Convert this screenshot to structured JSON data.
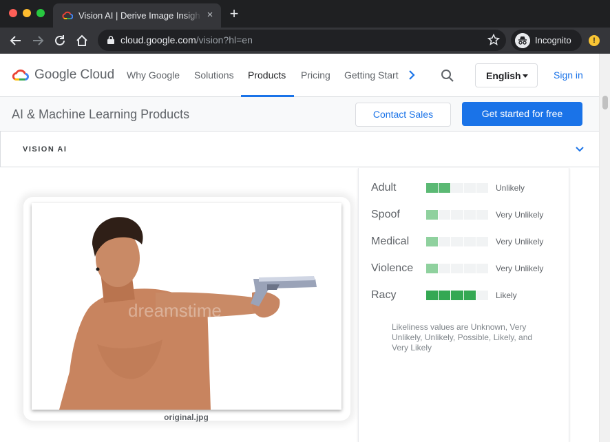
{
  "browser": {
    "tab_title": "Vision AI | Derive Image Insights",
    "url_host": "cloud.google.com",
    "url_path": "/vision?hl=en",
    "incognito_label": "Incognito",
    "alert_glyph": "!"
  },
  "header": {
    "logo_text": "Google Cloud",
    "nav": [
      "Why Google",
      "Solutions",
      "Products",
      "Pricing",
      "Getting Started"
    ],
    "active_nav": "Products",
    "language": "English",
    "sign_in": "Sign in"
  },
  "subheader": {
    "title": "AI & Machine Learning Products",
    "contact_sales": "Contact Sales",
    "get_started": "Get started for free"
  },
  "section": {
    "title": "VISION AI"
  },
  "image": {
    "caption": "original.jpg",
    "watermark": "dreamstime"
  },
  "safe_search": {
    "rows": [
      {
        "label": "Adult",
        "value": "Unlikely",
        "level": 2
      },
      {
        "label": "Spoof",
        "value": "Very Unlikely",
        "level": 1
      },
      {
        "label": "Medical",
        "value": "Very Unlikely",
        "level": 1
      },
      {
        "label": "Violence",
        "value": "Very Unlikely",
        "level": 1
      },
      {
        "label": "Racy",
        "value": "Likely",
        "level": 4
      }
    ],
    "max_level": 5,
    "note": "Likeliness values are Unknown, Very Unlikely, Unlikely, Possible, Likely, and Very Likely"
  },
  "colors": {
    "accent": "#1a73e8",
    "meter_on": "#34a853",
    "meter_off": "#f1f3f4"
  }
}
